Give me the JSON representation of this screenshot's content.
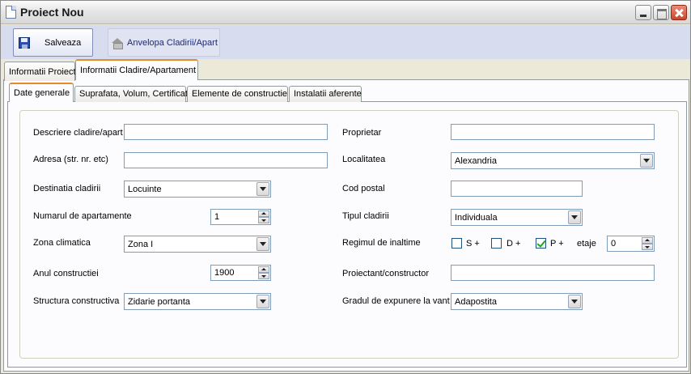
{
  "window": {
    "title": "Proiect Nou"
  },
  "toolbar": {
    "save_label": "Salveaza",
    "anvelopa_label": "Anvelopa Cladirii/Apart"
  },
  "outer_tabs": [
    {
      "label": "Informatii Proiect",
      "active": false
    },
    {
      "label": "Informatii Cladire/Apartament",
      "active": true
    }
  ],
  "inner_tabs": [
    {
      "label": "Date generale",
      "active": true
    },
    {
      "label": "Suprafata, Volum, Certificat",
      "active": false
    },
    {
      "label": "Elemente de constructie",
      "active": false
    },
    {
      "label": "Instalatii aferente",
      "active": false
    }
  ],
  "form": {
    "descriere": {
      "label": "Descriere cladire/apart",
      "value": ""
    },
    "adresa": {
      "label": "Adresa (str. nr. etc)",
      "value": ""
    },
    "destinatia": {
      "label": "Destinatia cladirii",
      "value": "Locuinte"
    },
    "nr_apartamente": {
      "label": "Numarul de apartamente",
      "value": "1"
    },
    "zona_climatica": {
      "label": "Zona climatica",
      "value": "Zona I"
    },
    "anul": {
      "label": "Anul constructiei",
      "value": "1900"
    },
    "structura": {
      "label": "Structura constructiva",
      "value": "Zidarie portanta"
    },
    "proprietar": {
      "label": "Proprietar",
      "value": ""
    },
    "localitatea": {
      "label": "Localitatea",
      "value": "Alexandria"
    },
    "cod_postal": {
      "label": "Cod postal",
      "value": ""
    },
    "tipul": {
      "label": "Tipul cladirii",
      "value": "Individuala"
    },
    "regimul": {
      "label": "Regimul de inaltime",
      "s_label": "S +",
      "s_checked": false,
      "d_label": "D +",
      "d_checked": false,
      "p_label": "P +",
      "p_checked": true,
      "etaje_label": "etaje",
      "etaje_value": "0"
    },
    "proiectant": {
      "label": "Proiectant/constructor",
      "value": ""
    },
    "gradul": {
      "label": "Gradul de expunere la vant",
      "value": "Adapostita"
    }
  }
}
